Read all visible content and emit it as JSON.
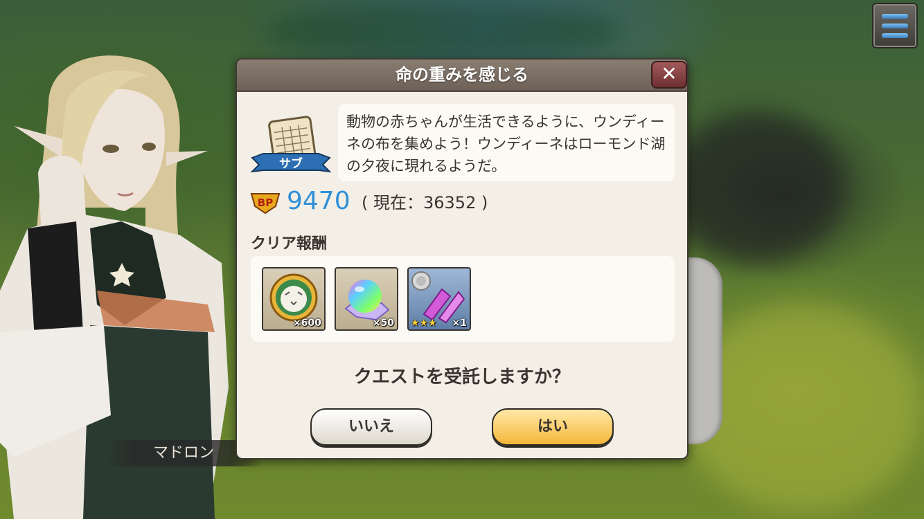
{
  "quest": {
    "title": "命の重みを感じる",
    "type_badge": "サブ",
    "description": "動物の赤ちゃんが生活できるように、ウンディーネの布を集めよう！ウンディーネはローモンド湖の夕夜に現れるようだ。",
    "bp_label": "BP",
    "bp_required": "9470",
    "bp_current": "( 現在：36352 )",
    "rewards_title": "クリア報酬",
    "rewards": [
      {
        "icon": "tiger-coin-icon",
        "quantity": "×600"
      },
      {
        "icon": "rainbow-orb-icon",
        "quantity": "×50"
      },
      {
        "icon": "crystal-shard-icon",
        "quantity": "×1",
        "stars": "★★★"
      }
    ],
    "prompt": "クエストを受託しますか？",
    "no_label": "いいえ",
    "yes_label": "はい",
    "close_label": "✕"
  },
  "speaker": {
    "name": "マドロン"
  },
  "colors": {
    "bp_value": "#2f8fd8",
    "yes_button": "#f6b73b",
    "header": "#7a6d63"
  }
}
